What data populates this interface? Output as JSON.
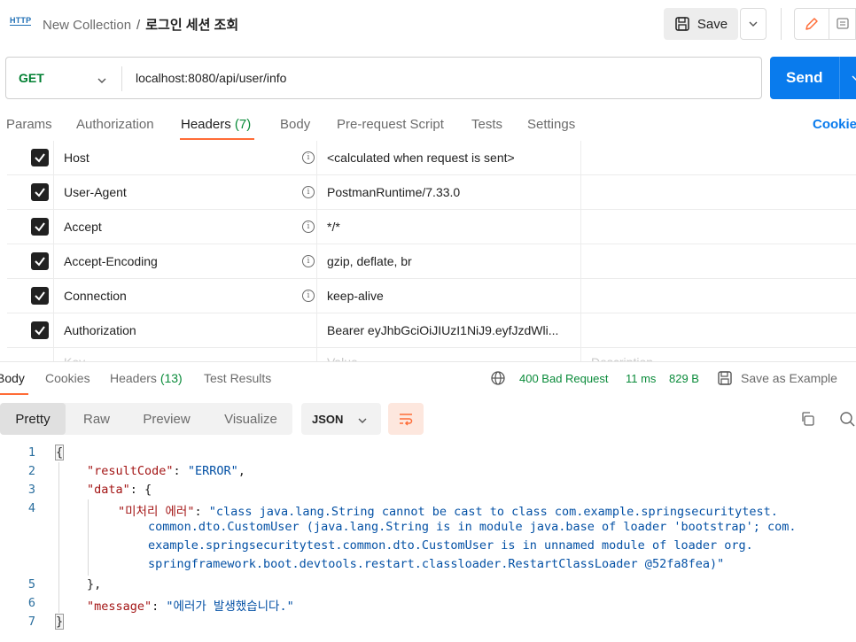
{
  "header": {
    "method_badge": "HTTP",
    "collection": "New Collection",
    "separator": "/",
    "request_name": "로그인 세션 조회",
    "save_label": "Save"
  },
  "request": {
    "method": "GET",
    "url": "localhost:8080/api/user/info",
    "send_label": "Send"
  },
  "request_tabs": [
    {
      "label": "Params"
    },
    {
      "label": "Authorization"
    },
    {
      "label": "Headers",
      "count": "(7)"
    },
    {
      "label": "Body"
    },
    {
      "label": "Pre-request Script"
    },
    {
      "label": "Tests"
    },
    {
      "label": "Settings"
    }
  ],
  "cookies_label": "Cookies",
  "headers_table": {
    "rows": [
      {
        "key": "Host",
        "value": "<calculated when request is sent>",
        "info": true,
        "checked": true
      },
      {
        "key": "User-Agent",
        "value": "PostmanRuntime/7.33.0",
        "info": true,
        "checked": true
      },
      {
        "key": "Accept",
        "value": "*/*",
        "info": true,
        "checked": true
      },
      {
        "key": "Accept-Encoding",
        "value": "gzip, deflate, br",
        "info": true,
        "checked": true
      },
      {
        "key": "Connection",
        "value": "keep-alive",
        "info": true,
        "checked": true
      },
      {
        "key": "Authorization",
        "value": "Bearer eyJhbGciOiJIUzI1NiJ9.eyfJzdWli...",
        "info": false,
        "checked": true
      }
    ],
    "ghost_key": "Key",
    "ghost_value": "Value",
    "ghost_desc": "Description"
  },
  "response_tabs": [
    {
      "label": "Body"
    },
    {
      "label": "Cookies"
    },
    {
      "label": "Headers",
      "count": "(13)"
    },
    {
      "label": "Test Results"
    }
  ],
  "response_meta": {
    "status": "400 Bad Request",
    "time": "11 ms",
    "size": "829 B",
    "save_example": "Save as Example"
  },
  "view_modes": [
    "Pretty",
    "Raw",
    "Preview",
    "Visualize"
  ],
  "format": "JSON",
  "code": {
    "line_numbers": [
      "1",
      "2",
      "3",
      "4",
      "5",
      "6",
      "7"
    ],
    "open_brace": "{",
    "result_code_key": "\"resultCode\"",
    "result_code_value": "\"ERROR\"",
    "data_key": "\"data\"",
    "error_key": "\"미처리 에러\"",
    "error_value_lines": [
      "\"class java.lang.String cannot be cast to class com.example.springsecuritytest.",
      "common.dto.CustomUser (java.lang.String is in module java.base of loader 'bootstrap'; com.",
      "example.springsecuritytest.common.dto.CustomUser is in unnamed module of loader org.",
      "springframework.boot.devtools.restart.classloader.RestartClassLoader @52fa8fea)\""
    ],
    "message_key": "\"message\"",
    "message_value": "\"에러가 발생했습니다.\"",
    "close_brace": "}"
  },
  "colors": {
    "accent": "#ff6c37",
    "send": "#097bed",
    "method_get": "#007f31",
    "status": "#0a8b3a",
    "json_key": "#a31515",
    "json_string": "#0451a5"
  }
}
